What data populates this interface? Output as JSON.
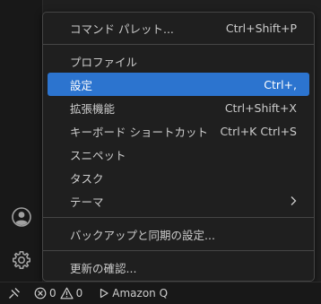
{
  "menu": {
    "items": [
      {
        "label": "コマンド パレット...",
        "shortcut": "Ctrl+Shift+P"
      },
      {
        "label": "プロファイル",
        "shortcut": ""
      },
      {
        "label": "設定",
        "shortcut": "Ctrl+,"
      },
      {
        "label": "拡張機能",
        "shortcut": "Ctrl+Shift+X"
      },
      {
        "label": "キーボード ショートカット",
        "shortcut": "Ctrl+K Ctrl+S"
      },
      {
        "label": "スニペット",
        "shortcut": ""
      },
      {
        "label": "タスク",
        "shortcut": ""
      },
      {
        "label": "テーマ",
        "shortcut": ""
      },
      {
        "label": "バックアップと同期の設定...",
        "shortcut": ""
      },
      {
        "label": "更新の確認...",
        "shortcut": ""
      }
    ],
    "active_index": 2
  },
  "statusbar": {
    "errors": "0",
    "warnings": "0",
    "amazon_q": "Amazon Q"
  },
  "colors": {
    "highlight": "#2c74cf",
    "menu_bg": "#1f1f1f",
    "text": "#cccccc"
  },
  "icons": {
    "activity_accounts": "account-icon",
    "activity_manage": "gear-icon",
    "remote": "remote-icon",
    "errors": "error-icon",
    "warnings": "warning-icon",
    "amazon_q": "play-icon",
    "submenu": "chevron-right-icon"
  }
}
